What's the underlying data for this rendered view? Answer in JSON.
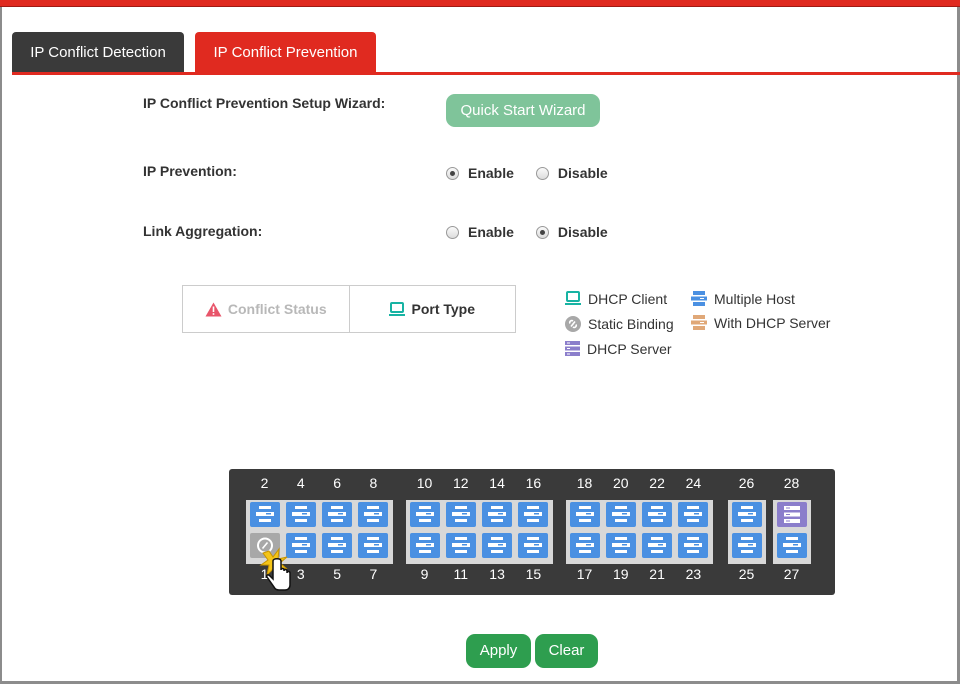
{
  "tabs": {
    "detection": "IP Conflict Detection",
    "prevention": "IP Conflict Prevention"
  },
  "wizard": {
    "label": "IP Conflict Prevention Setup Wizard:",
    "button": "Quick Start Wizard"
  },
  "ip_prevention": {
    "label": "IP Prevention:",
    "enable": "Enable",
    "disable": "Disable",
    "selected": "enable"
  },
  "link_aggregation": {
    "label": "Link Aggregation:",
    "enable": "Enable",
    "disable": "Disable",
    "selected": "disable"
  },
  "view_toggle": {
    "conflict_status": "Conflict Status",
    "port_type": "Port Type"
  },
  "legend": {
    "dhcp_client": "DHCP Client",
    "static_binding": "Static Binding",
    "dhcp_server": "DHCP Server",
    "multiple_host": "Multiple Host",
    "with_dhcp_server": "With DHCP Server"
  },
  "colors": {
    "accent": "#e02a20",
    "dhcp_client": "#17b3a3",
    "static_binding": "#a8a8a8",
    "dhcp_server": "#8b7ecb",
    "multiple_host": "#4a90e2",
    "with_dhcp_server": "#e0a878",
    "apply": "#2e9e4f"
  },
  "ports": [
    {
      "n": "1",
      "type": "static-binding"
    },
    {
      "n": "2",
      "type": "multiple-host"
    },
    {
      "n": "3",
      "type": "multiple-host"
    },
    {
      "n": "4",
      "type": "multiple-host"
    },
    {
      "n": "5",
      "type": "multiple-host"
    },
    {
      "n": "6",
      "type": "multiple-host"
    },
    {
      "n": "7",
      "type": "multiple-host"
    },
    {
      "n": "8",
      "type": "multiple-host"
    },
    {
      "n": "9",
      "type": "multiple-host"
    },
    {
      "n": "10",
      "type": "multiple-host"
    },
    {
      "n": "11",
      "type": "multiple-host"
    },
    {
      "n": "12",
      "type": "multiple-host"
    },
    {
      "n": "13",
      "type": "multiple-host"
    },
    {
      "n": "14",
      "type": "multiple-host"
    },
    {
      "n": "15",
      "type": "multiple-host"
    },
    {
      "n": "16",
      "type": "multiple-host"
    },
    {
      "n": "17",
      "type": "multiple-host"
    },
    {
      "n": "18",
      "type": "multiple-host"
    },
    {
      "n": "19",
      "type": "multiple-host"
    },
    {
      "n": "20",
      "type": "multiple-host"
    },
    {
      "n": "21",
      "type": "multiple-host"
    },
    {
      "n": "22",
      "type": "multiple-host"
    },
    {
      "n": "23",
      "type": "multiple-host"
    },
    {
      "n": "24",
      "type": "multiple-host"
    },
    {
      "n": "25",
      "type": "multiple-host"
    },
    {
      "n": "26",
      "type": "multiple-host"
    },
    {
      "n": "27",
      "type": "multiple-host"
    },
    {
      "n": "28",
      "type": "dhcp-server"
    }
  ],
  "actions": {
    "apply": "Apply",
    "clear": "Clear"
  }
}
